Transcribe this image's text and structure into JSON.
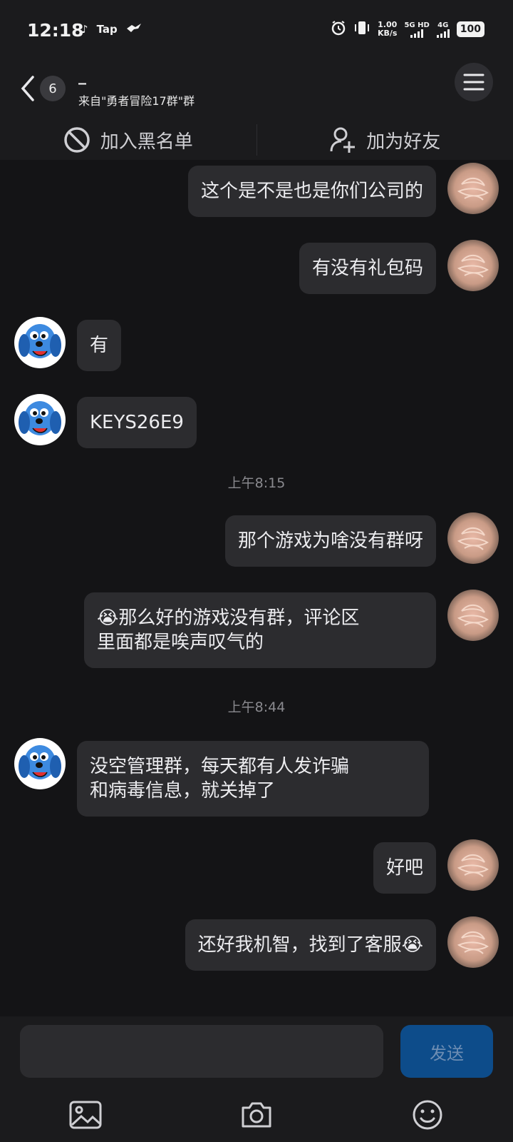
{
  "status_bar": {
    "time": "12:18",
    "app_label": "Tap",
    "speed_value": "1.00",
    "speed_unit": "KB/s",
    "net1": "5G HD",
    "net2": "4G",
    "battery": "100"
  },
  "header": {
    "back_count": "6",
    "title": "_",
    "subtitle": "来自\"勇者冒险17群\"群"
  },
  "actions": {
    "block_label": "加入黑名单",
    "add_friend_label": "加为好友"
  },
  "messages": [
    {
      "side": "right",
      "text": "这个是不是也是你们公司的"
    },
    {
      "side": "right",
      "text": "有没有礼包码"
    },
    {
      "side": "left",
      "text": "有"
    },
    {
      "side": "left",
      "text": "KEYS26E9"
    },
    {
      "type": "time",
      "text": "上午8:15"
    },
    {
      "side": "right",
      "text": "那个游戏为啥没有群呀"
    },
    {
      "side": "right",
      "text_line1": "😭那么好的游戏没有群，评论区",
      "text_line2": "里面都是唉声叹气的"
    },
    {
      "type": "time",
      "text": "上午8:44"
    },
    {
      "side": "left",
      "text_line1": "没空管理群，每天都有人发诈骗",
      "text_line2": "和病毒信息，就关掉了"
    },
    {
      "side": "right",
      "text": "好吧"
    },
    {
      "side": "right",
      "text": "还好我机智，找到了客服😭"
    }
  ],
  "composer": {
    "send_label": "发送"
  },
  "colors": {
    "background": "#141416",
    "bubble": "#2c2c2f",
    "send_button": "#0d4c8a"
  }
}
